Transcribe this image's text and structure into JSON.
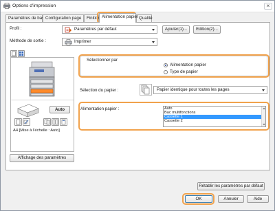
{
  "window": {
    "title": "Options d'impression",
    "close_glyph": "×"
  },
  "tabs": [
    {
      "label": "Paramètres de base"
    },
    {
      "label": "Configuration page"
    },
    {
      "label": "Finition"
    },
    {
      "label": "Alimentation papier"
    },
    {
      "label": "Qualité"
    }
  ],
  "profile": {
    "label": "Profil :",
    "value": "Paramètres par défaut",
    "icon": "printer-settings-icon",
    "add_button": "Ajouter(1)...",
    "edit_button": "Edition(2)..."
  },
  "output": {
    "label": "Méthode de sortie :",
    "value": "Imprimer",
    "icon": "printer-icon"
  },
  "preview": {
    "auto_button": "Auto",
    "caption": "A4 [Mise à l'échelle : Auto]"
  },
  "select_by": {
    "title": "Sélectionner par",
    "options": [
      {
        "label": "Alimentation papier",
        "checked": true
      },
      {
        "label": "Type de papier",
        "checked": false
      }
    ]
  },
  "paper_selection": {
    "label": "Sélection du papier :",
    "value": "Papier identique pour toutes les pages",
    "icon": "pages-icon"
  },
  "paper_source": {
    "label": "Alimentation papier :",
    "items": [
      {
        "label": "Auto",
        "selected": false
      },
      {
        "label": "Bac multifonctions",
        "selected": false
      },
      {
        "label": "Cassette 1",
        "selected": true
      },
      {
        "label": "Cassette 2",
        "selected": false
      }
    ]
  },
  "show_settings_button": "Affichage des paramètres",
  "restore_button": "Rétablir les paramètres par défaut",
  "footer": {
    "ok": "OK",
    "cancel": "Annuler",
    "help": "Aide"
  },
  "colors": {
    "highlight": "#f1a24c",
    "selection": "#3399ff"
  }
}
